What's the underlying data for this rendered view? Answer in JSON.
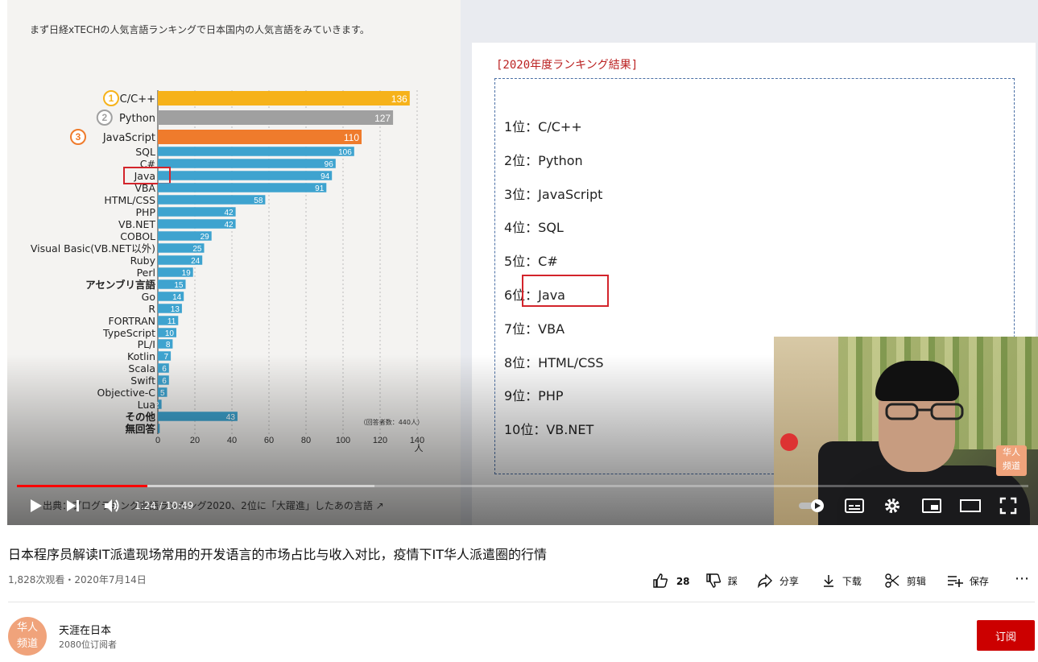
{
  "video": {
    "slide_caption": "まず日経xTECHの人気言語ランキングで日本国内の人気言語をみていきます。",
    "source_text": "出典：プログラミング言語ランキング2020、2位に「大躍進」したあの言語",
    "current_time": "1:24 / 10:49",
    "progress_fraction": 0.1287,
    "pip_watermark": [
      "华人",
      "频道"
    ]
  },
  "ranking": {
    "title": "[2020年度ランキング結果]",
    "items": [
      "1位：C/C++",
      "2位：Python",
      "3位：JavaScript",
      "4位：SQL",
      "5位：C#",
      "6位：Java",
      "7位：VBA",
      "8位：HTML/CSS",
      "9位：PHP",
      "10位：VB.NET"
    ],
    "highlighted_index": 5
  },
  "chart_data": {
    "type": "bar",
    "orientation": "horizontal",
    "categories": [
      "C/C++",
      "Python",
      "JavaScript",
      "SQL",
      "C#",
      "Java",
      "VBA",
      "HTML/CSS",
      "PHP",
      "VB.NET",
      "COBOL",
      "Visual Basic(VB.NET以外)",
      "Ruby",
      "Perl",
      "アセンブリ言語",
      "Go",
      "R",
      "FORTRAN",
      "TypeScript",
      "PL/I",
      "Kotlin",
      "Scala",
      "Swift",
      "Objective-C",
      "Lua",
      "その他",
      "無回答"
    ],
    "values": [
      136,
      127,
      110,
      106,
      96,
      94,
      91,
      58,
      42,
      42,
      29,
      25,
      24,
      19,
      15,
      14,
      13,
      11,
      10,
      8,
      7,
      6,
      6,
      5,
      2,
      43,
      1
    ],
    "rank_badges": [
      "1",
      "2",
      "3"
    ],
    "highlighted_category": "Java",
    "xlim": [
      0,
      140
    ],
    "xticks": [
      0,
      20,
      40,
      60,
      80,
      100,
      120,
      140
    ],
    "xlabel": "人",
    "note": "（回答者数：440人）",
    "grid": true,
    "colors": {
      "rank1": "#f6b21a",
      "rank2": "#a0a0a0",
      "rank3": "#ef7b2c",
      "default": "#3ea3cf"
    }
  },
  "info": {
    "title": "日本程序员解读IT派遣现场常用的开发语言的市场占比与收入对比，疫情下IT华人派遣圈的行情",
    "views_date": "1,828次观看・2020年7月14日",
    "actions": {
      "like_count": "28",
      "dislike": "踩",
      "share": "分享",
      "download": "下载",
      "clip": "剪辑",
      "save": "保存"
    }
  },
  "channel": {
    "avatar_text": [
      "华人",
      "频道"
    ],
    "name": "天涯在日本",
    "subscribers": "2080位订阅者",
    "subscribe_label": "订阅"
  },
  "icons": {
    "play": "play-icon",
    "next": "next-icon",
    "volume": "volume-icon",
    "autoplay": "autoplay-toggle-icon",
    "subtitles": "subtitles-icon",
    "settings": "gear-icon",
    "miniplayer": "miniplayer-icon",
    "theater": "theater-icon",
    "fullscreen": "fullscreen-icon",
    "like": "thumb-up-icon",
    "dislike": "thumb-down-icon",
    "share": "share-icon",
    "download": "download-icon",
    "clip": "scissors-icon",
    "save": "playlist-add-icon",
    "more": "more-icon"
  }
}
